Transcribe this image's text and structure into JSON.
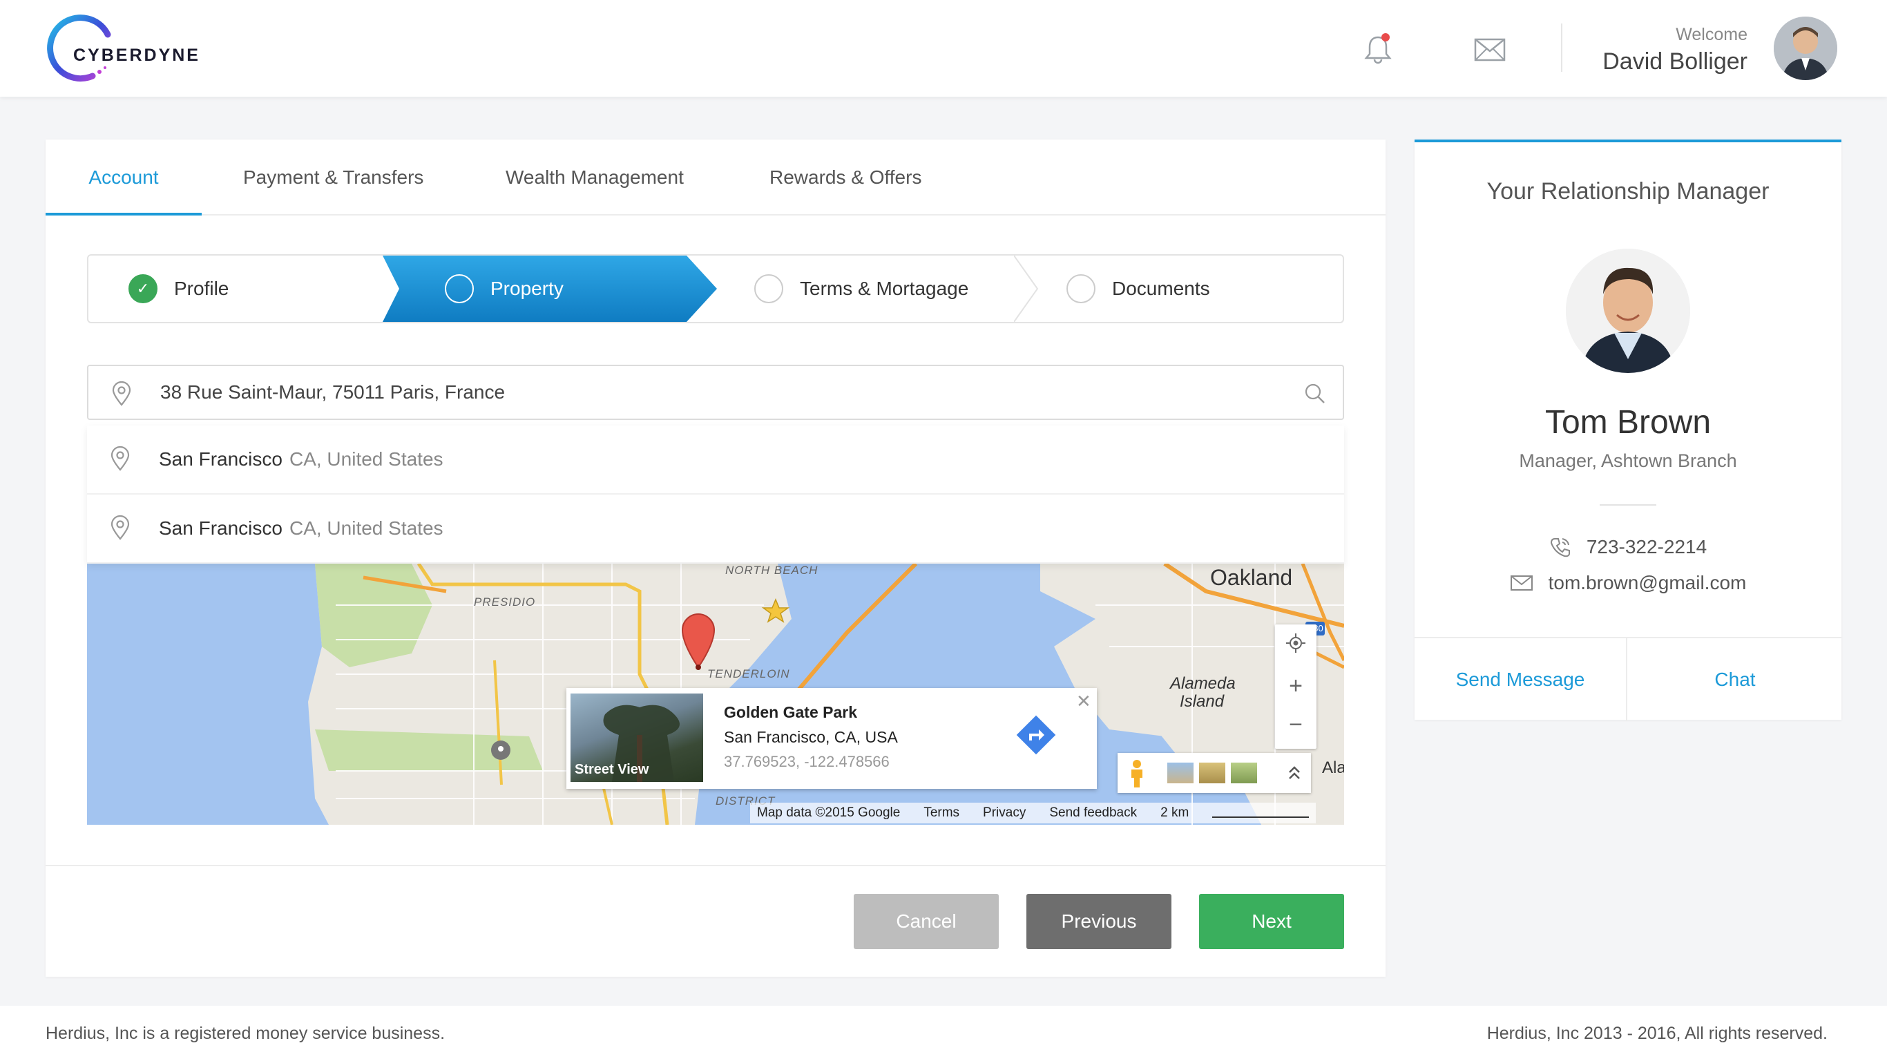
{
  "brand": {
    "name": "CYBERDYNE"
  },
  "header": {
    "welcome_label": "Welcome",
    "user_name": "David Bolliger",
    "icons": [
      "bell-icon",
      "mail-icon",
      "user-avatar"
    ],
    "notification_color": "#e94b4b"
  },
  "tabs": [
    {
      "label": "Account",
      "active": true
    },
    {
      "label": "Payment & Transfers",
      "active": false
    },
    {
      "label": "Wealth Management",
      "active": false
    },
    {
      "label": "Rewards & Offers",
      "active": false
    }
  ],
  "steps": [
    {
      "label": "Profile",
      "state": "done"
    },
    {
      "label": "Property",
      "state": "current"
    },
    {
      "label": "Terms & Mortagage",
      "state": "pending"
    },
    {
      "label": "Documents",
      "state": "pending"
    }
  ],
  "search": {
    "value": "38 Rue Saint-Maur, 75011 Paris, France",
    "icon": "search-icon"
  },
  "suggestions": [
    {
      "city": "San Francisco",
      "region": "CA, United States"
    },
    {
      "city": "San Francisco",
      "region": "CA, United States"
    }
  ],
  "map": {
    "labels": {
      "oakland": "Oakland",
      "alameda": "Alameda",
      "island": "Island",
      "presidio": "PRESIDIO",
      "north_beach": "NORTH BEACH",
      "tenderloin": "TENDERLOIN",
      "district": "DISTRICT",
      "ala": "Ala",
      "highway": "880"
    },
    "place_card": {
      "title": "Golden Gate Park",
      "address": "San Francisco, CA, USA",
      "coords": "37.769523, -122.478566",
      "street_view_label": "Street View"
    },
    "attribution": {
      "map_data": "Map data ©2015 Google",
      "terms": "Terms",
      "privacy": "Privacy",
      "feedback": "Send feedback",
      "scale": "2 km"
    },
    "controls": {
      "zoom_in": "+",
      "zoom_out": "−"
    }
  },
  "buttons": {
    "cancel": "Cancel",
    "previous": "Previous",
    "next": "Next"
  },
  "manager": {
    "title": "Your Relationship Manager",
    "name": "Tom Brown",
    "role": "Manager, Ashtown Branch",
    "phone": "723-322-2214",
    "email": "tom.brown@gmail.com",
    "send_message": "Send Message",
    "chat": "Chat"
  },
  "footer": {
    "left": "Herdius, Inc is a registered money service business.",
    "right": "Herdius, Inc 2013 - 2016, All rights reserved."
  },
  "colors": {
    "accent": "#1c9ad8",
    "success": "#3aa757",
    "next_button": "#3aaf5d",
    "water": "#a3c4f0",
    "land": "#ebe8e1"
  }
}
